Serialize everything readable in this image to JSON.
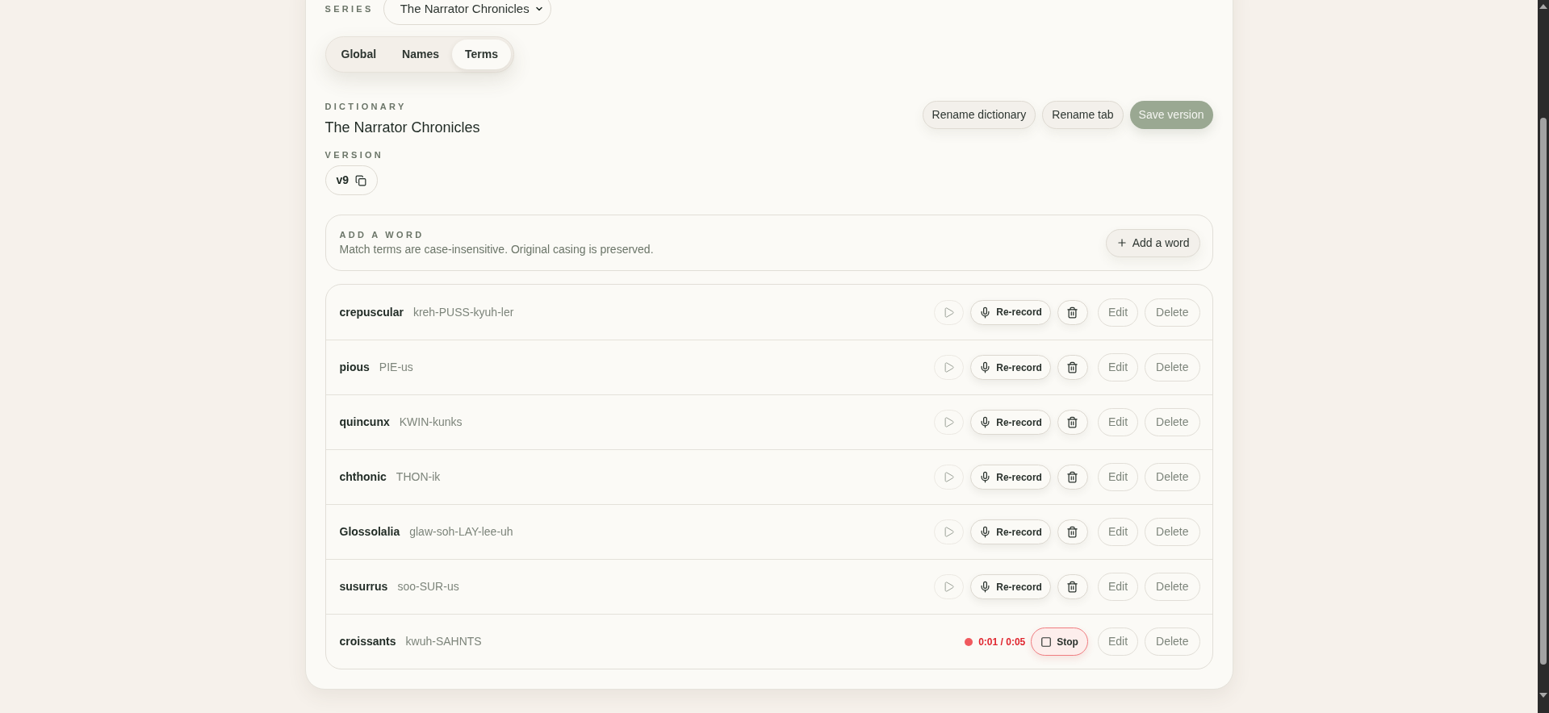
{
  "series": {
    "label": "SERIES",
    "value": "The Narrator Chronicles"
  },
  "tabs": [
    {
      "label": "Global",
      "selected": false
    },
    {
      "label": "Names",
      "selected": false
    },
    {
      "label": "Terms",
      "selected": true
    }
  ],
  "dictionary": {
    "label": "DICTIONARY",
    "name": "The Narrator Chronicles",
    "version_label": "VERSION",
    "version": "v9"
  },
  "actions": [
    {
      "label": "Rename dictionary",
      "kind": "secondary"
    },
    {
      "label": "Rename tab",
      "kind": "secondary"
    },
    {
      "label": "Save version",
      "kind": "primary"
    }
  ],
  "add_word": {
    "label": "ADD A WORD",
    "hint": "Match terms are case-insensitive. Original casing is preserved.",
    "button": "Add a word"
  },
  "terms": [
    {
      "word": "crepuscular",
      "pronunciation": "kreh-PUSS-kyuh-ler",
      "kind": "recorded",
      "record_label": "Re-record",
      "edit_label": "Edit",
      "delete_label": "Delete"
    },
    {
      "word": "pious",
      "pronunciation": "PIE-us",
      "kind": "recorded",
      "record_label": "Re-record",
      "edit_label": "Edit",
      "delete_label": "Delete"
    },
    {
      "word": "quincunx",
      "pronunciation": "KWIN-kunks",
      "kind": "recorded",
      "record_label": "Re-record",
      "edit_label": "Edit",
      "delete_label": "Delete"
    },
    {
      "word": "chthonic",
      "pronunciation": "THON-ik",
      "kind": "recorded",
      "record_label": "Re-record",
      "edit_label": "Edit",
      "delete_label": "Delete"
    },
    {
      "word": "Glossolalia",
      "pronunciation": "glaw-soh-LAY-lee-uh",
      "kind": "recorded",
      "record_label": "Re-record",
      "edit_label": "Edit",
      "delete_label": "Delete"
    },
    {
      "word": "susurrus",
      "pronunciation": "soo-SUR-us",
      "kind": "recorded",
      "record_label": "Re-record",
      "edit_label": "Edit",
      "delete_label": "Delete"
    },
    {
      "word": "croissants",
      "pronunciation": "kwuh-SAHNTS",
      "kind": "recording",
      "timer": "0:01 / 0:05",
      "stop_label": "Stop",
      "edit_label": "Edit",
      "delete_label": "Delete"
    }
  ]
}
